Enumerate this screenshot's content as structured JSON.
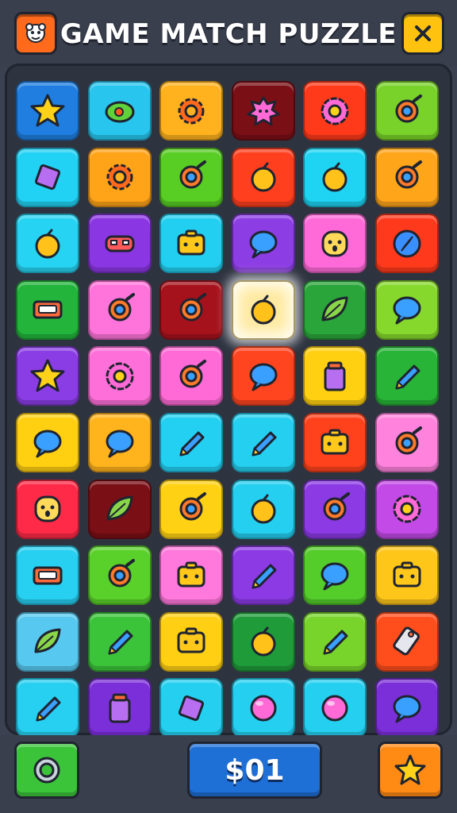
{
  "header": {
    "title": "GAME MATCH PUZZLE",
    "menu_icon": "face-icon",
    "close_icon": "close-icon",
    "colors": {
      "menu": "#ff6a1c",
      "close": "#ffc20e"
    }
  },
  "grid": {
    "rows": 10,
    "cols": 6,
    "tiles": [
      {
        "color": "#1f7ee0",
        "icon": "star"
      },
      {
        "color": "#28c6ee",
        "icon": "lemon"
      },
      {
        "color": "#ffb21e",
        "icon": "gear"
      },
      {
        "color": "#7a0f16",
        "icon": "splat"
      },
      {
        "color": "#ff3a1a",
        "icon": "flower"
      },
      {
        "color": "#79d22a",
        "icon": "ring"
      },
      {
        "color": "#22d2f4",
        "icon": "diamond"
      },
      {
        "color": "#ffa318",
        "icon": "gear"
      },
      {
        "color": "#58cd24",
        "icon": "ring"
      },
      {
        "color": "#ff3f1e",
        "icon": "fruit"
      },
      {
        "color": "#1ed4f2",
        "icon": "fruit"
      },
      {
        "color": "#ffa51a",
        "icon": "ring"
      },
      {
        "color": "#27d3f2",
        "icon": "fruit"
      },
      {
        "color": "#8a36e2",
        "icon": "mask"
      },
      {
        "color": "#23cff0",
        "icon": "box"
      },
      {
        "color": "#8d3de4",
        "icon": "bubble"
      },
      {
        "color": "#ff6ad8",
        "icon": "face"
      },
      {
        "color": "#ff3a1c",
        "icon": "compass"
      },
      {
        "color": "#23b43c",
        "icon": "tape"
      },
      {
        "color": "#ff74da",
        "icon": "ring"
      },
      {
        "color": "#a5121c",
        "icon": "ring"
      },
      {
        "color": "#ffeaa0",
        "icon": "fruit",
        "selected": true
      },
      {
        "color": "#2aa53a",
        "icon": "leaf"
      },
      {
        "color": "#86d82c",
        "icon": "bubble"
      },
      {
        "color": "#8a3de4",
        "icon": "star"
      },
      {
        "color": "#ff6fd9",
        "icon": "flower"
      },
      {
        "color": "#ff6ad6",
        "icon": "ring"
      },
      {
        "color": "#ff4520",
        "icon": "bubble"
      },
      {
        "color": "#ffd012",
        "icon": "jar"
      },
      {
        "color": "#28b437",
        "icon": "pencil"
      },
      {
        "color": "#ffd012",
        "icon": "bubble"
      },
      {
        "color": "#ffb31c",
        "icon": "bubble"
      },
      {
        "color": "#23d0f2",
        "icon": "pencil"
      },
      {
        "color": "#24cff0",
        "icon": "pencil"
      },
      {
        "color": "#ff421c",
        "icon": "box"
      },
      {
        "color": "#ff82dc",
        "icon": "ring"
      },
      {
        "color": "#ff2a47",
        "icon": "face"
      },
      {
        "color": "#7a0f16",
        "icon": "leaf"
      },
      {
        "color": "#ffd114",
        "icon": "ring"
      },
      {
        "color": "#24cff0",
        "icon": "fruit"
      },
      {
        "color": "#8b3ae4",
        "icon": "ring"
      },
      {
        "color": "#c34ae6",
        "icon": "flower"
      },
      {
        "color": "#27cff1",
        "icon": "tape"
      },
      {
        "color": "#5ad12a",
        "icon": "ring"
      },
      {
        "color": "#ff78dc",
        "icon": "box"
      },
      {
        "color": "#8b3ae4",
        "icon": "pencil"
      },
      {
        "color": "#54cc2a",
        "icon": "bubble"
      },
      {
        "color": "#ffc61a",
        "icon": "box"
      },
      {
        "color": "#57c8f0",
        "icon": "leaf"
      },
      {
        "color": "#3bc43a",
        "icon": "pencil"
      },
      {
        "color": "#ffcf14",
        "icon": "box"
      },
      {
        "color": "#1f9b3a",
        "icon": "fruit"
      },
      {
        "color": "#78d42a",
        "icon": "pencil"
      },
      {
        "color": "#ff4d1c",
        "icon": "tag"
      },
      {
        "color": "#27cff1",
        "icon": "pencil"
      },
      {
        "color": "#7b2fd8",
        "icon": "jar"
      },
      {
        "color": "#24cff0",
        "icon": "diamond"
      },
      {
        "color": "#24cff0",
        "icon": "ball"
      },
      {
        "color": "#24cff0",
        "icon": "ball"
      },
      {
        "color": "#7b2fd8",
        "icon": "bubble"
      }
    ]
  },
  "footer": {
    "left_icon": "ring-icon",
    "score_label": "$01",
    "right_icon": "star-icon",
    "colors": {
      "left": "#3bc43a",
      "score": "#1e6fd6",
      "right": "#ff8a14"
    }
  }
}
